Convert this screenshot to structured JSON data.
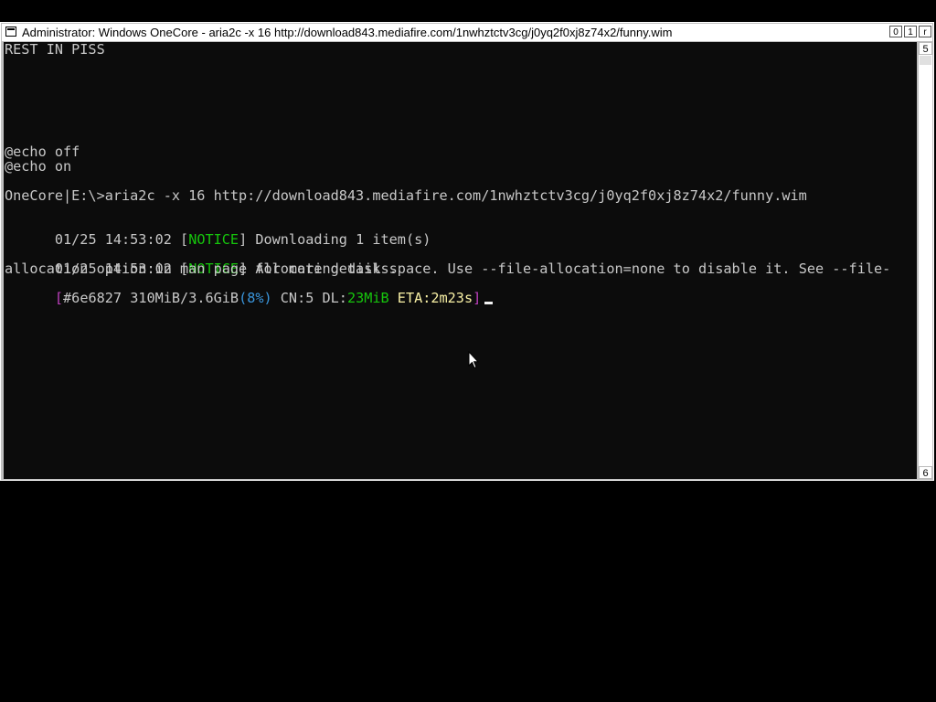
{
  "window": {
    "title": "Administrator:  Windows OneCore - aria2c  -x 16 http://download843.mediafire.com/1nwhztctv3cg/j0yq2f0xj8z74x2/funny.wim",
    "buttons": {
      "minimize": "0",
      "maximize": "1",
      "close": "r"
    }
  },
  "scrollbar": {
    "up_glyph": "5",
    "down_glyph": "6"
  },
  "console": {
    "lines": {
      "l1": "REST IN PISS",
      "l2": "@echo off",
      "l3": "@echo on",
      "l4": "OneCore|E:\\>aria2c -x 16 http://download843.mediafire.com/1nwhztctv3cg/j0yq2f0xj8z74x2/funny.wim",
      "l5_time": "01/25 14:53:02 ",
      "l5_open": "[",
      "l5_tag": "NOTICE",
      "l5_close": "]",
      "l5_msg": " Downloading 1 item(s)",
      "l6_time": "01/25 14:53:02 ",
      "l6_open": "[",
      "l6_tag": "NOTICE",
      "l6_close": "]",
      "l6_msg": " Allocating disk space. Use --file-allocation=none to disable it. See --file-",
      "l7": "allocation option in man page for more details."
    },
    "progress": {
      "open": "[",
      "gid": "#6e6827",
      "size": " 310MiB/3.6GiB",
      "percent": "(8%)",
      "cn": " CN:5",
      "dl_label": " DL:",
      "dl_speed": "23MiB",
      "eta": " ETA:2m23s",
      "close": "]"
    }
  },
  "colors": {
    "console_bg": "#0c0c0c",
    "console_fg": "#c8c8c8",
    "notice": "#16c60c",
    "percent": "#3a96dd",
    "bracket": "#c040c0",
    "titlebar_bg": "#ffffff"
  }
}
